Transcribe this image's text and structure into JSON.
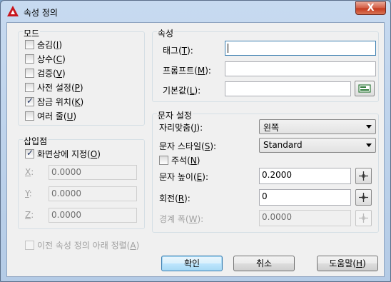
{
  "window": {
    "title": "속성 정의",
    "close_label": "X"
  },
  "mode": {
    "title": "모드",
    "options": [
      {
        "text": "숨김(",
        "key": "I",
        "end": ")",
        "checked": false
      },
      {
        "text": "상수(",
        "key": "C",
        "end": ")",
        "checked": false
      },
      {
        "text": "검증(",
        "key": "V",
        "end": ")",
        "checked": false
      },
      {
        "text": "사전 설정(",
        "key": "P",
        "end": ")",
        "checked": false
      },
      {
        "text": "잠금 위치(",
        "key": "K",
        "end": ")",
        "checked": true
      },
      {
        "text": "여러 줄(",
        "key": "U",
        "end": ")",
        "checked": false
      }
    ]
  },
  "insertion": {
    "title": "삽입점",
    "specify_text": "화면상에 지정(",
    "specify_key": "O",
    "specify_end": ")",
    "specify_checked": true,
    "x_key": "X",
    "x_rest": ":",
    "x_value": "0.0000",
    "y_key": "Y",
    "y_rest": ":",
    "y_value": "0.0000",
    "z_key": "Z",
    "z_rest": ":",
    "z_value": "0.0000"
  },
  "attribute": {
    "title": "속성",
    "tag_text": "태그(",
    "tag_key": "T",
    "tag_end": "):",
    "tag_value": "",
    "prompt_text": "프롬프트(",
    "prompt_key": "M",
    "prompt_end": "):",
    "prompt_value": "",
    "default_text": "기본값(",
    "default_key": "L",
    "default_end": "):",
    "default_value": ""
  },
  "text_settings": {
    "title": "문자 설정",
    "justify_text": "자리맞춤(",
    "justify_key": "J",
    "justify_end": "):",
    "justify_value": "왼쪽",
    "style_text": "문자 스타일(",
    "style_key": "S",
    "style_end": "):",
    "style_value": "Standard",
    "annotative_text": "주석(",
    "annotative_key": "N",
    "annotative_end": ")",
    "annotative_checked": false,
    "height_text": "문자 높이(",
    "height_key": "E",
    "height_end": "):",
    "height_value": "0.2000",
    "rotation_text": "회전(",
    "rotation_key": "R",
    "rotation_end": "):",
    "rotation_value": "0",
    "boundary_text": "경계 폭(",
    "boundary_key": "W",
    "boundary_end": "):",
    "boundary_value": "0.0000"
  },
  "align_below": {
    "text": "이전 속성 정의 아래 정렬(",
    "key": "A",
    "end": ")",
    "checked": false
  },
  "buttons": {
    "ok": "확인",
    "cancel": "취소",
    "help_text": "도움말(",
    "help_key": "H",
    "help_end": ")"
  },
  "colors": {
    "accent": "#3c7fb1",
    "title_icon": "#c8161d"
  }
}
